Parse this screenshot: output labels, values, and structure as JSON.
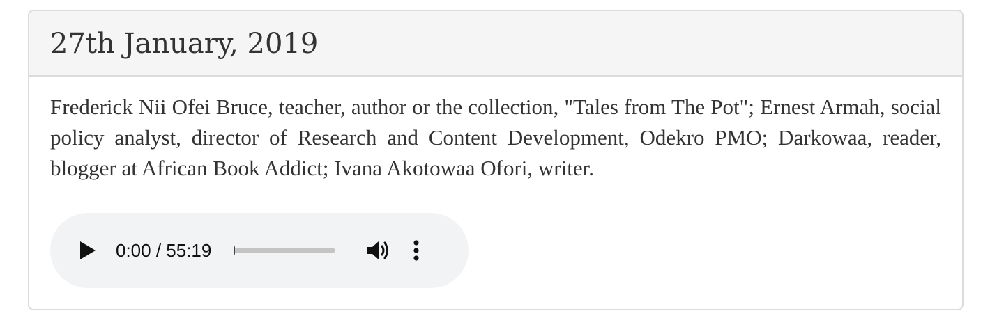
{
  "episode": {
    "date_title": "27th January, 2019",
    "description": "Frederick Nii Ofei Bruce, teacher, author or the collection, \"Tales from The Pot\"; Ernest Armah, social policy analyst, director of Research and Content Development, Odekro PMO; Darkowaa, reader, blogger at African Book Addict; Ivana Akotowaa Ofori, writer."
  },
  "audio_player": {
    "time_display": "0:00 / 55:19",
    "progress": 0,
    "play_icon": "play-icon",
    "volume_icon": "volume-icon",
    "more_icon": "more-options-icon"
  }
}
